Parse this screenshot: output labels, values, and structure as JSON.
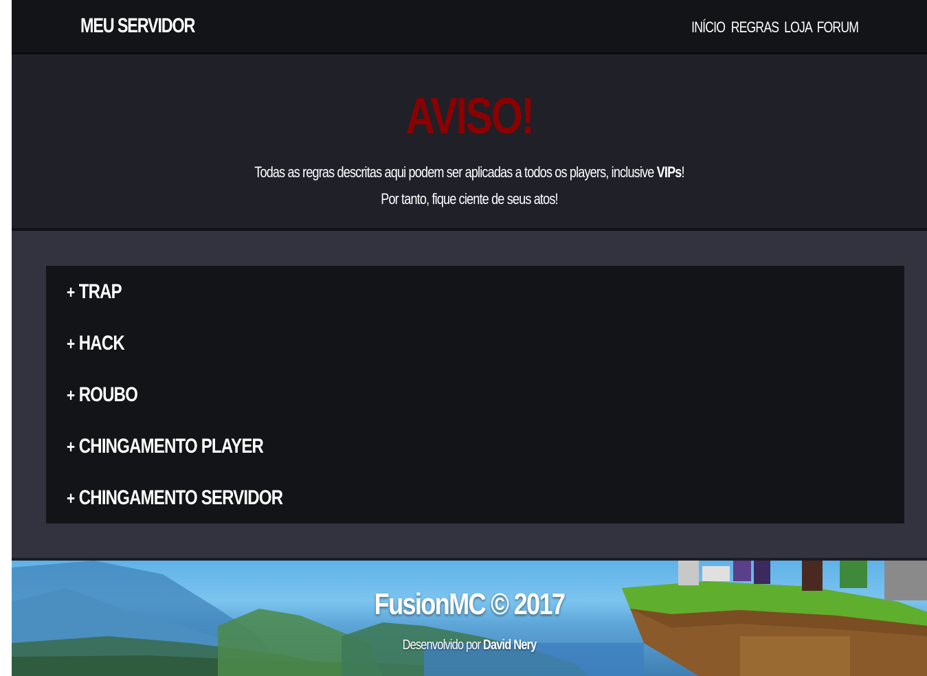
{
  "navbar": {
    "brand": "MEU SERVIDOR",
    "links": [
      "INÍCIO",
      "REGRAS",
      "LOJA",
      "FORUM"
    ]
  },
  "hero": {
    "title": "AVISO!",
    "line1_prefix": "Todas as regras descritas aqui podem ser aplicadas a todos os players, inclusive ",
    "line1_bold": "VIPs",
    "line1_suffix": "!",
    "line2": "Por tanto, fique ciente de seus atos!"
  },
  "rules": {
    "prefix": "+",
    "items": [
      "TRAP",
      "HACK",
      "ROUBO",
      "CHINGAMENTO PLAYER",
      "CHINGAMENTO SERVIDOR"
    ]
  },
  "footer": {
    "title": "FusionMC © 2017",
    "credit_prefix": "Desenvolvido por ",
    "credit_name": "David Nery",
    "background_image": "minecraft-landscape"
  },
  "colors": {
    "navbar_bg": "#131418",
    "hero_bg": "#1f2028",
    "content_bg": "#32333f",
    "rules_bg": "#131418",
    "warning_red": "#8b0000",
    "text": "#ffffff"
  }
}
